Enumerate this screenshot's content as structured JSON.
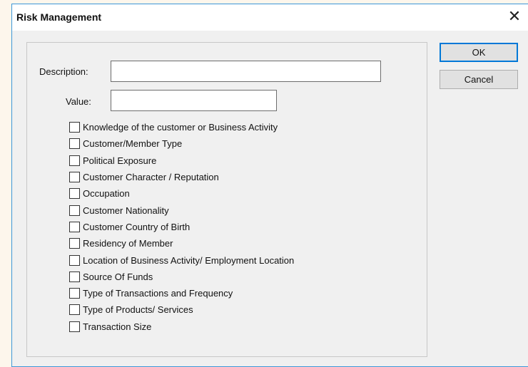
{
  "dialog": {
    "title": "Risk Management",
    "close_glyph": "✕"
  },
  "form": {
    "description_label": "Description:",
    "description_value": "",
    "value_label": "Value:",
    "value_value": ""
  },
  "buttons": {
    "ok_label": "OK",
    "cancel_label": "Cancel"
  },
  "checkboxes": [
    {
      "label": "Knowledge of the customer or Business Activity",
      "checked": false
    },
    {
      "label": "Customer/Member Type",
      "checked": false
    },
    {
      "label": "Political Exposure",
      "checked": false
    },
    {
      "label": "Customer Character / Reputation",
      "checked": false
    },
    {
      "label": "Occupation",
      "checked": false
    },
    {
      "label": "Customer Nationality",
      "checked": false
    },
    {
      "label": "Customer Country of Birth",
      "checked": false
    },
    {
      "label": "Residency of Member",
      "checked": false
    },
    {
      "label": "Location of Business Activity/ Employment Location",
      "checked": false
    },
    {
      "label": "Source Of Funds",
      "checked": false
    },
    {
      "label": "Type of Transactions and Frequency",
      "checked": false
    },
    {
      "label": "Type of Products/ Services",
      "checked": false
    },
    {
      "label": "Transaction Size",
      "checked": false
    }
  ],
  "colors": {
    "window_border": "#3c97d8",
    "dialog_background": "#f0f0f0",
    "default_button_border": "#0078d7"
  }
}
